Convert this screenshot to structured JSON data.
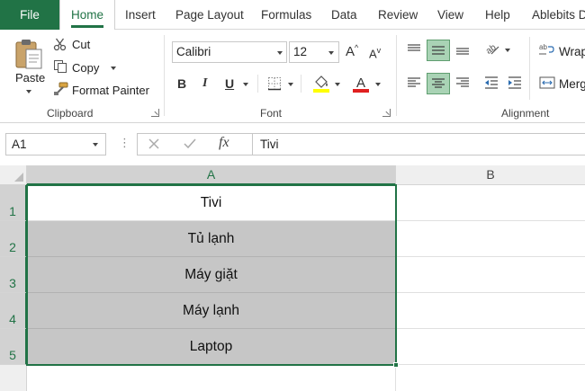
{
  "tabs": [
    {
      "label": "File"
    },
    {
      "label": "Home"
    },
    {
      "label": "Insert"
    },
    {
      "label": "Page Layout"
    },
    {
      "label": "Formulas"
    },
    {
      "label": "Data"
    },
    {
      "label": "Review"
    },
    {
      "label": "View"
    },
    {
      "label": "Help"
    },
    {
      "label": "Ablebits D"
    }
  ],
  "clipboard": {
    "paste_label": "Paste",
    "cut_label": "Cut",
    "copy_label": "Copy",
    "format_painter_label": "Format Painter",
    "group_label": "Clipboard"
  },
  "font": {
    "font_name": "Calibri",
    "font_size": "12",
    "bold": "B",
    "italic": "I",
    "underline": "U",
    "grow": "A",
    "shrink": "A",
    "font_color_letter": "A",
    "group_label": "Font",
    "highlight_color": "#ffff00",
    "font_color": "#e02020"
  },
  "alignment": {
    "wrap_label": "Wrap",
    "merge_label": "Merg",
    "group_label": "Alignment"
  },
  "formula_bar": {
    "name_box": "A1",
    "fx": "fx",
    "value": "Tivi"
  },
  "grid": {
    "columns": [
      "A",
      "B"
    ],
    "rows": [
      "1",
      "2",
      "3",
      "4",
      "5"
    ],
    "cells": [
      "Tivi",
      "Tủ lạnh",
      "Máy giặt",
      "Máy lạnh",
      "Laptop"
    ]
  },
  "colors": {
    "accent": "#217346",
    "selection_fill": "#c6c6c6"
  }
}
